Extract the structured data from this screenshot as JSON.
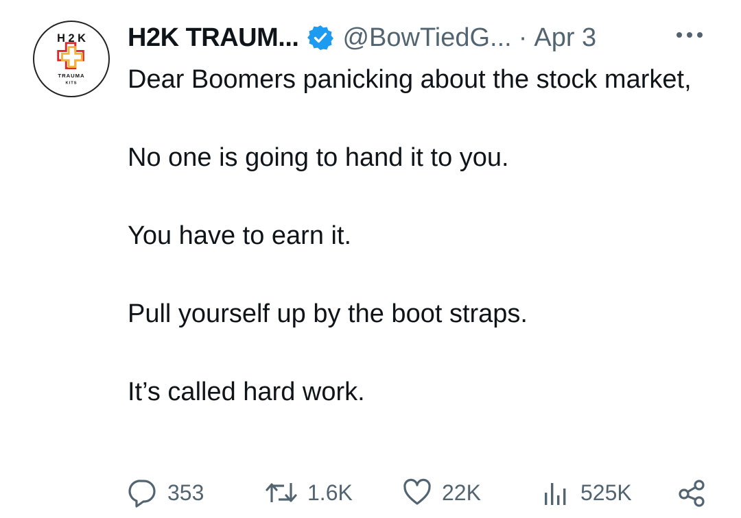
{
  "author": {
    "display_name": "H2K TRAUM...",
    "handle": "@BowTiedG...",
    "separator": "·",
    "date": "Apr 3",
    "verified": true,
    "avatar": {
      "top_text": "H 2 K",
      "bottom_text": "TRAUMA",
      "bottom_text_2": "KITS",
      "cross_colors": [
        "#e2252b",
        "#f2b233"
      ]
    }
  },
  "tweet": {
    "paragraphs": [
      "Dear Boomers panicking about the stock market,",
      "No one is going to hand it to you.",
      "You have to earn it.",
      "Pull yourself up by the boot straps.",
      "It’s called hard work."
    ]
  },
  "actions": {
    "replies": "353",
    "retweets": "1.6K",
    "likes": "22K",
    "views": "525K"
  },
  "icons": {
    "verified": "verified-badge-icon",
    "more": "more-options-icon",
    "reply": "reply-icon",
    "retweet": "retweet-icon",
    "like": "heart-icon",
    "views": "views-bar-chart-icon",
    "share": "share-icon"
  },
  "colors": {
    "text": "#0f1419",
    "secondary": "#536471",
    "verified": "#1d9bf0"
  }
}
